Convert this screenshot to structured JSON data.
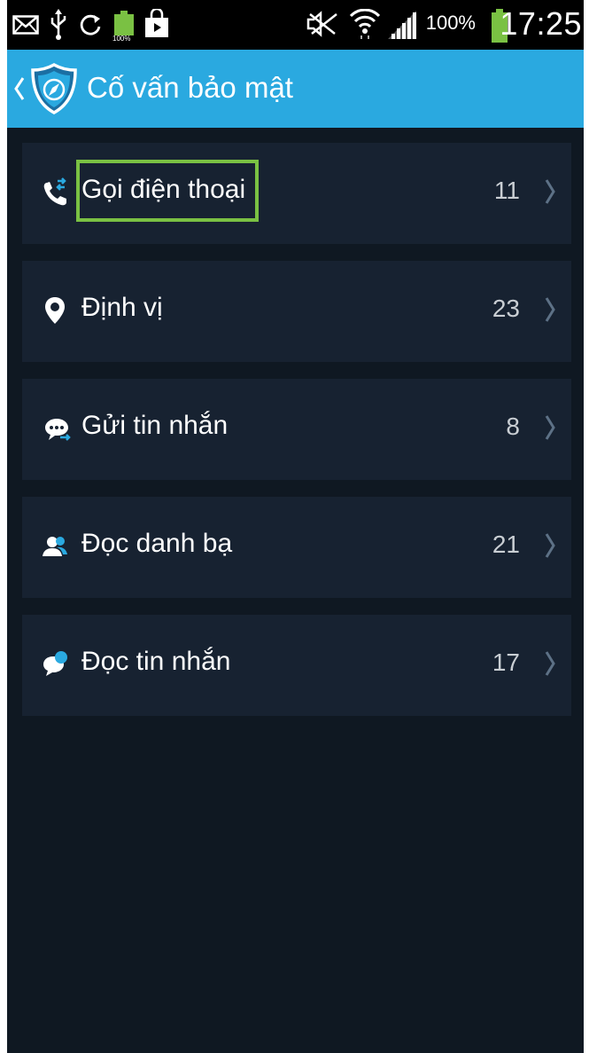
{
  "status_bar": {
    "battery_percent": "100%",
    "time": "17:25",
    "charging_small_label": "100%",
    "icons": [
      "mail-icon",
      "usb-icon",
      "sync-icon",
      "battery-charging-icon",
      "shopping-bag-icon",
      "no-sound-icon",
      "wifi-icon",
      "signal-icon",
      "battery-icon"
    ]
  },
  "header": {
    "title": "Cố vấn bảo mật",
    "logo_icon": "shield-compass-icon",
    "back_icon": "chevron-left-icon",
    "background_color": "#2aa9e0"
  },
  "permissions": [
    {
      "label": "Gọi điện thoại",
      "count": "11",
      "icon": "phone-call-icon",
      "highlighted": true
    },
    {
      "label": "Định vị",
      "count": "23",
      "icon": "location-pin-icon",
      "highlighted": false
    },
    {
      "label": "Gửi tin nhắn",
      "count": "8",
      "icon": "send-message-icon",
      "highlighted": false
    },
    {
      "label": "Đọc danh bạ",
      "count": "21",
      "icon": "contacts-icon",
      "highlighted": false
    },
    {
      "label": "Đọc tin nhắn",
      "count": "17",
      "icon": "read-message-icon",
      "highlighted": false
    }
  ],
  "colors": {
    "screen_background": "#0f1822",
    "row_background": "#172231",
    "highlight_border": "#7ac143",
    "accent_blue": "#2aa9e0"
  }
}
